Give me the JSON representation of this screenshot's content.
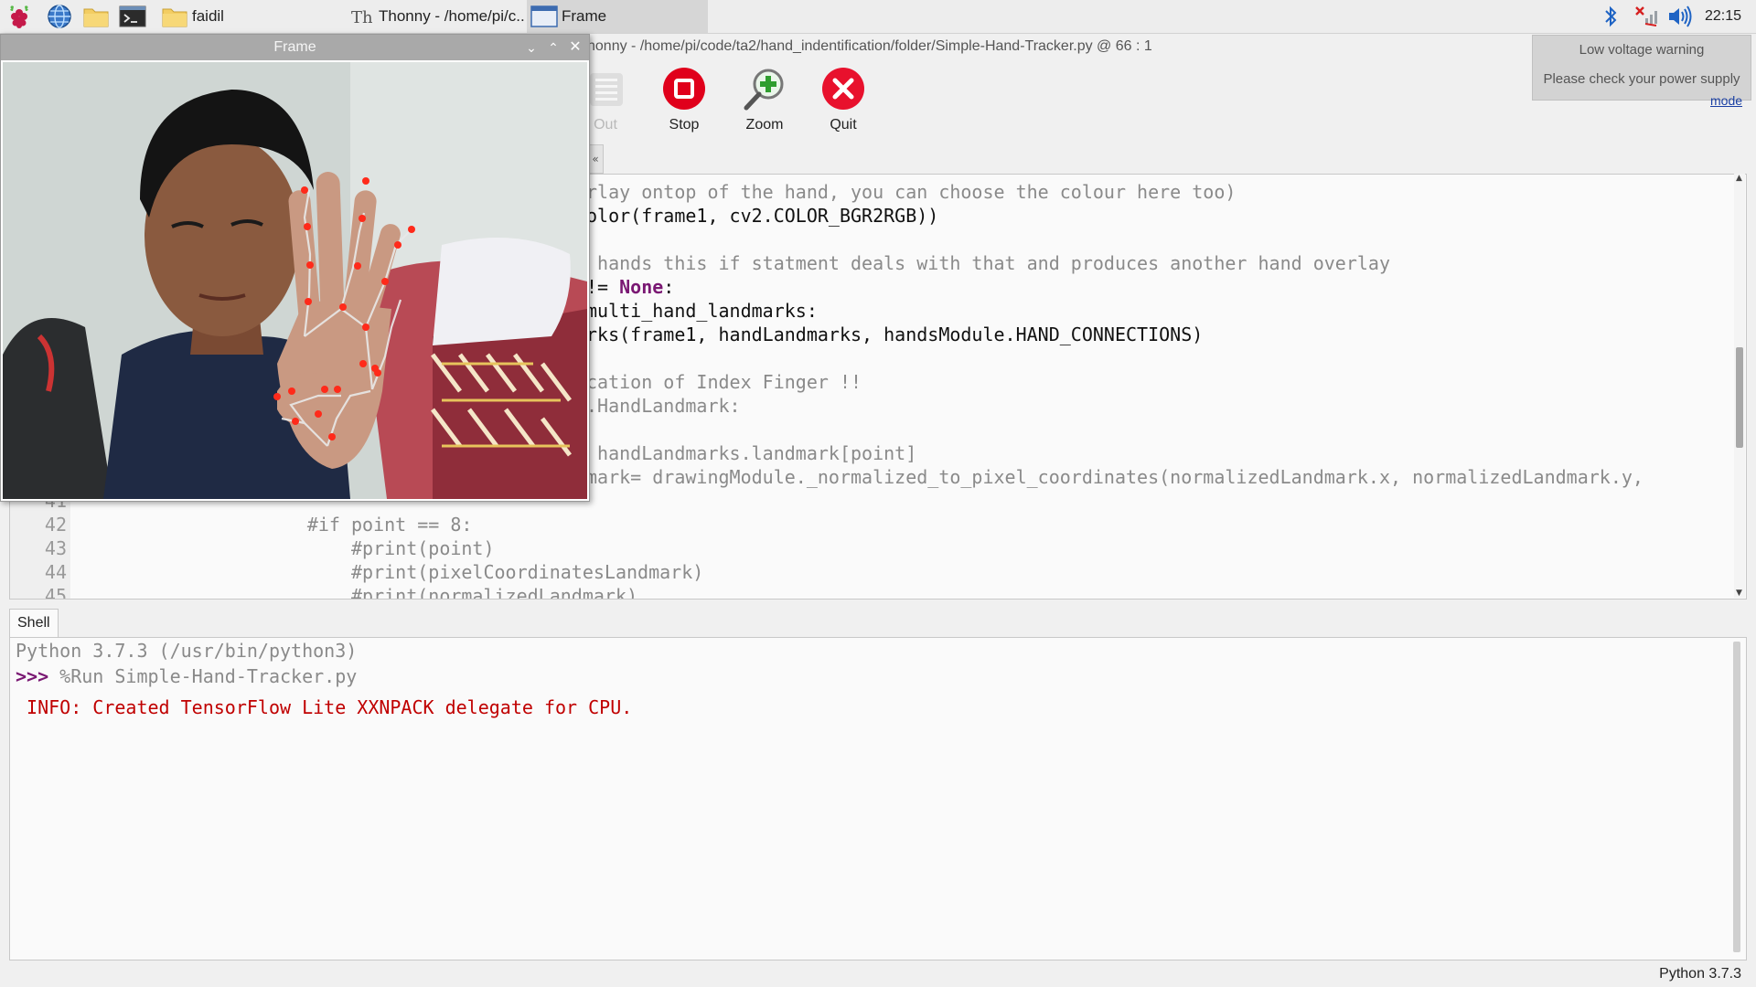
{
  "taskbar": {
    "launchers": [
      "raspberry-menu-icon",
      "web-browser-icon",
      "file-manager-icon",
      "terminal-icon"
    ],
    "windows": [
      {
        "label": "faidil",
        "icon": "folder-icon"
      },
      {
        "label": "Thonny  -  /home/pi/c...",
        "icon": "thonny-icon"
      },
      {
        "label": "Frame",
        "icon": "window-icon"
      }
    ],
    "tray_icons": [
      "bluetooth-icon",
      "network-disconnected-icon",
      "volume-icon"
    ],
    "clock": "22:15"
  },
  "notification": {
    "title": "Low voltage warning",
    "body": "Please check your power supply"
  },
  "thonny": {
    "title": "honny  -  /home/pi/code/ta2/hand_indentification/folder/Simple-Hand-Tracker.py  @  66 : 1",
    "toolbar": {
      "step_out": "Out",
      "stop": "Stop",
      "zoom": "Zoom",
      "quit": "Quit"
    },
    "mode_link": "mode",
    "editor": {
      "lines": [
        {
          "num": "",
          "text": "rlay ontop of the hand, you can choose the colour here too)",
          "style": "comment"
        },
        {
          "num": "",
          "text": "olor(frame1, cv2.COLOR_BGR2RGB))",
          "style": "normal"
        },
        {
          "num": "",
          "text": "",
          "style": "normal"
        },
        {
          "num": "",
          "text": " hands this if statment deals with that and produces another hand overlay",
          "style": "comment"
        },
        {
          "num": "",
          "text": "!= ",
          "kw": "None",
          "after": ":",
          "style": "mixed"
        },
        {
          "num": "",
          "text": "multi_hand_landmarks:",
          "style": "normal"
        },
        {
          "num": "",
          "text": "rks(frame1, handLandmarks, handsModule.HAND_CONNECTIONS)",
          "style": "normal"
        },
        {
          "num": "",
          "text": "",
          "style": "normal"
        },
        {
          "num": "",
          "text": "cation of Index Finger !!",
          "style": "comment"
        },
        {
          "num": "",
          "text": ".HandLandmark:",
          "style": "comment"
        },
        {
          "num": "",
          "text": "",
          "style": "normal"
        },
        {
          "num": "",
          "text": " handLandmarks.landmark[point]",
          "style": "comment"
        },
        {
          "num": "",
          "text": "mark= drawingModule._normalized_to_pixel_coordinates(normalizedLandmark.x, normalizedLandmark.y,",
          "style": "comment"
        },
        {
          "num": "41",
          "text": "",
          "style": "comment"
        },
        {
          "num": "42",
          "text": "                    #if point == 8:",
          "style": "comment"
        },
        {
          "num": "43",
          "text": "                        #print(point)",
          "style": "comment"
        },
        {
          "num": "44",
          "text": "                        #print(pixelCoordinatesLandmark)",
          "style": "comment"
        },
        {
          "num": "45",
          "text": "                        #print(normalizedLandmark)",
          "style": "comment"
        }
      ]
    },
    "shell": {
      "tab": "Shell",
      "version": "Python 3.7.3 (/usr/bin/python3)",
      "prompt": ">>>",
      "command": " %Run Simple-Hand-Tracker.py",
      "info": " INFO: Created TensorFlow Lite XXNPACK delegate for CPU."
    },
    "status": "Python 3.7.3"
  },
  "frame_window": {
    "title": "Frame",
    "controls": [
      "chevron-down-icon",
      "chevron-up-icon",
      "close-icon"
    ]
  },
  "colors": {
    "stop": "#e0001b",
    "quit": "#e8112d",
    "zoom": "#2f9e2f",
    "landmark": "#ff2a1a"
  }
}
